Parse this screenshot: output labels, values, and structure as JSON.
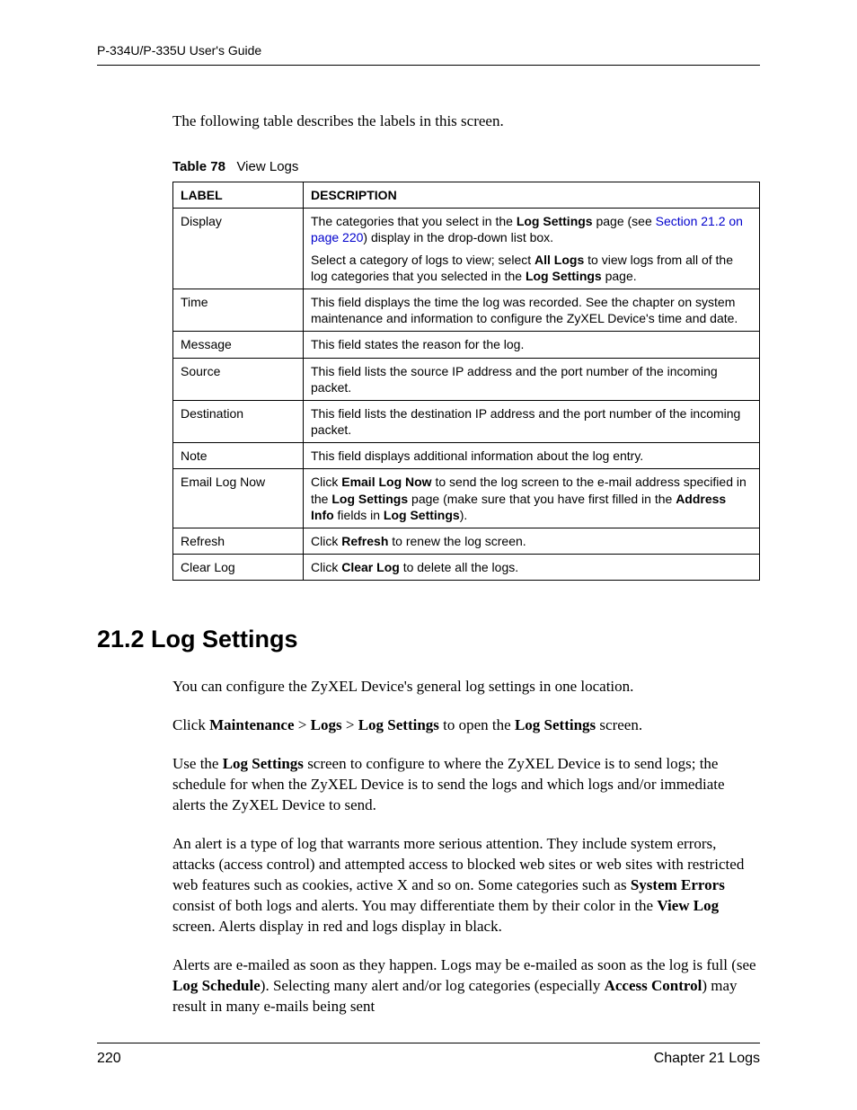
{
  "header": {
    "guide_title": "P-334U/P-335U User's Guide"
  },
  "intro": "The following table describes the labels in this screen.",
  "table": {
    "caption_prefix": "Table 78",
    "caption_title": "View Logs",
    "headers": {
      "label": "LABEL",
      "description": "DESCRIPTION"
    },
    "rows": {
      "display": {
        "label": "Display",
        "p1_pre": "The categories that you select in the ",
        "p1_bold1": "Log Settings",
        "p1_mid": " page (see ",
        "p1_link": "Section 21.2 on page 220",
        "p1_post": ") display in the drop-down list box.",
        "p2_pre": "Select a category of logs to view; select ",
        "p2_bold1": "All Logs",
        "p2_mid": " to view logs from all of the log categories that you selected in the ",
        "p2_bold2": "Log Settings",
        "p2_post": " page."
      },
      "time": {
        "label": "Time",
        "desc": "This field displays the time the log was recorded. See the chapter on system maintenance and information to configure the ZyXEL Device's time and date."
      },
      "message": {
        "label": "Message",
        "desc": "This field states the reason for the log."
      },
      "source": {
        "label": "Source",
        "desc": "This field lists the source IP address and the port number of the incoming packet."
      },
      "destination": {
        "label": "Destination",
        "desc": "This field lists the destination IP address and the port number of the incoming packet."
      },
      "note": {
        "label": "Note",
        "desc": "This field displays additional information about the log entry."
      },
      "email_log_now": {
        "label": "Email Log Now",
        "pre": "Click ",
        "b1": "Email Log Now",
        "mid1": " to send the log screen to the e-mail address specified in the ",
        "b2": "Log Settings",
        "mid2": " page (make sure that you have first filled in the ",
        "b3": "Address Info",
        "mid3": " fields in ",
        "b4": "Log Settings",
        "post": ")."
      },
      "refresh": {
        "label": "Refresh",
        "pre": "Click ",
        "b1": "Refresh",
        "post": " to renew the log screen."
      },
      "clear_log": {
        "label": "Clear Log",
        "pre": "Click ",
        "b1": "Clear Log",
        "post": " to delete all the logs."
      }
    }
  },
  "section": {
    "heading": "21.2  Log Settings",
    "p1": "You can configure the ZyXEL Device's general log settings in one location.",
    "p2": {
      "pre": "Click ",
      "b1": "Maintenance",
      "sep1": " > ",
      "b2": "Logs",
      "sep2": " > ",
      "b3": "Log Settings",
      "mid": " to open the ",
      "b4": "Log Settings",
      "post": " screen."
    },
    "p3": {
      "pre": "Use the ",
      "b1": "Log Settings",
      "post": " screen to configure to where the ZyXEL Device is to send logs; the schedule for when the ZyXEL Device is to send the logs and which logs and/or immediate alerts the ZyXEL Device to send."
    },
    "p4": {
      "pre": "An alert is a type of log that warrants more serious attention. They include system errors, attacks (access control) and attempted access to blocked web sites or web sites with restricted web features such as cookies, active X and so on. Some categories such as ",
      "b1": "System Errors",
      "mid": " consist of both logs and alerts. You may differentiate them by their color in the ",
      "b2": "View Log",
      "post": " screen. Alerts display in red and logs display in black."
    },
    "p5": {
      "pre": "Alerts are e-mailed as soon as they happen. Logs may be e-mailed as soon as the log is full (see ",
      "b1": "Log Schedule",
      "mid": "). Selecting many alert and/or log categories (especially ",
      "b2": "Access Control",
      "post": ") may result in many e-mails being sent"
    }
  },
  "footer": {
    "page_number": "220",
    "chapter": "Chapter 21 Logs"
  }
}
